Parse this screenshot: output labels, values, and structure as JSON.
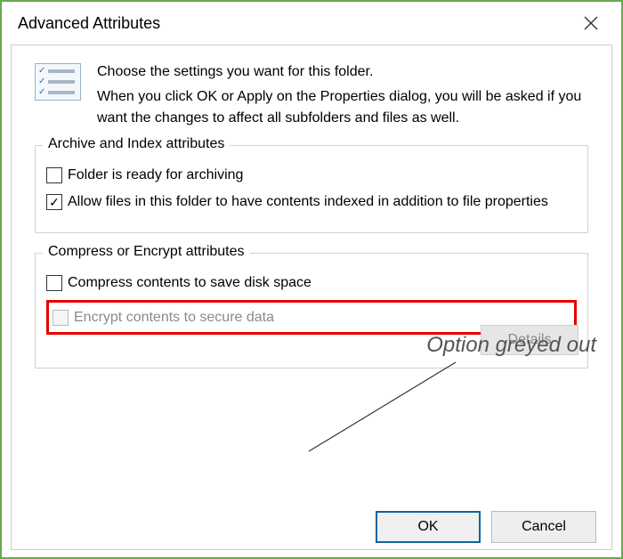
{
  "window": {
    "title": "Advanced Attributes"
  },
  "header": {
    "line1": "Choose the settings you want for this folder.",
    "line2": "When you click OK or Apply on the Properties dialog, you will be asked if you want the changes to affect all subfolders and files as well."
  },
  "groups": {
    "archive": {
      "legend": "Archive and Index attributes",
      "ready_label": "Folder is ready for archiving",
      "ready_checked": false,
      "index_label": "Allow files in this folder to have contents indexed in addition to file properties",
      "index_checked": true
    },
    "compress": {
      "legend": "Compress or Encrypt attributes",
      "compress_label": "Compress contents to save disk space",
      "compress_checked": false,
      "encrypt_label": "Encrypt contents to secure data",
      "encrypt_checked": false,
      "encrypt_enabled": false,
      "details_label": "Details"
    }
  },
  "buttons": {
    "ok": "OK",
    "cancel": "Cancel"
  },
  "annotation": {
    "text": "Option greyed out"
  }
}
